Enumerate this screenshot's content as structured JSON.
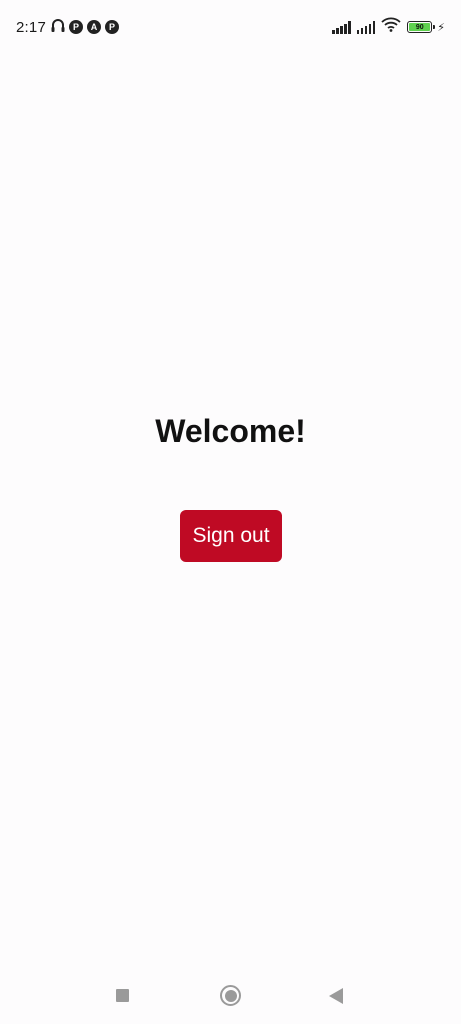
{
  "status_bar": {
    "time": "2:17",
    "icons": [
      "headphones-icon",
      "notification-p-icon",
      "notification-a-icon",
      "notification-p-icon"
    ],
    "notif_glyphs": [
      "P",
      "A",
      "P"
    ],
    "battery": "90",
    "right_icons": [
      "signal-icon",
      "signal-icon",
      "wifi-icon",
      "battery-icon",
      "charging-icon"
    ]
  },
  "main": {
    "heading": "Welcome!",
    "sign_out_label": "Sign out"
  },
  "colors": {
    "accent": "#bf0a24",
    "background": "#fdfcfd",
    "nav_icons": "#9a9a9a",
    "battery_fill": "#5fd14f"
  },
  "nav_bar": {
    "icons": [
      "recents-icon",
      "home-icon",
      "back-icon"
    ]
  }
}
